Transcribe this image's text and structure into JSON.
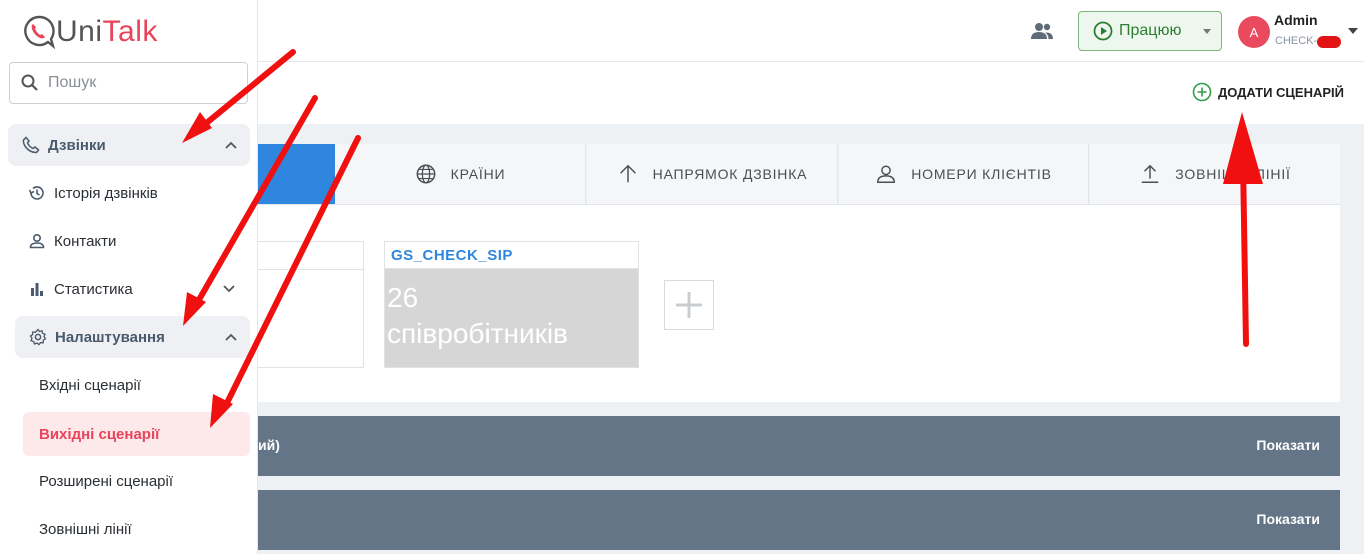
{
  "app": {
    "logo_prefix": "Uni",
    "logo_suffix": "Talk"
  },
  "search": {
    "placeholder": "Пошук"
  },
  "sidebar": {
    "calls_group": "Дзвінки",
    "items": [
      {
        "label": "Історія дзвінків",
        "icon": "history-icon"
      },
      {
        "label": "Контакти",
        "icon": "person-icon"
      },
      {
        "label": "Статистика",
        "icon": "bar-chart-icon"
      }
    ],
    "settings_group": "Налаштування",
    "subitems": [
      {
        "label": "Вхідні сценарії",
        "active": false
      },
      {
        "label": "Вихідні сценарії",
        "active": true
      },
      {
        "label": "Розширені сценарії",
        "active": false
      },
      {
        "label": "Зовнішні лінії",
        "active": false
      }
    ]
  },
  "header": {
    "status_label": "Працюю",
    "user_initial": "A",
    "user_name": "Admin",
    "user_org": "CHECK-"
  },
  "toolbar": {
    "add_scenario_label": "ДОДАТИ СЦЕНАРІЙ"
  },
  "tabs": [
    {
      "label": "КРАЇНИ",
      "icon": "globe-icon"
    },
    {
      "label": "НАПРЯМОК ДЗВІНКА",
      "icon": "arrow-up-icon"
    },
    {
      "label": "НОМЕРИ КЛІЄНТІВ",
      "icon": "person-outline-icon"
    },
    {
      "label": "ЗОВНІШНІ ЛІНІЇ",
      "icon": "upload-icon"
    }
  ],
  "cards": {
    "sip_name": "GS_CHECK_SIP",
    "sip_count": "26",
    "sip_count_label": "співробітників"
  },
  "sections": [
    {
      "title": "ий)",
      "show_label": "Показати"
    },
    {
      "title": "",
      "show_label": "Показати"
    }
  ],
  "colors": {
    "accent_red": "#e8445a",
    "accent_blue": "#2e86de",
    "section_bg": "#647587",
    "status_green": "#2e7d32"
  }
}
